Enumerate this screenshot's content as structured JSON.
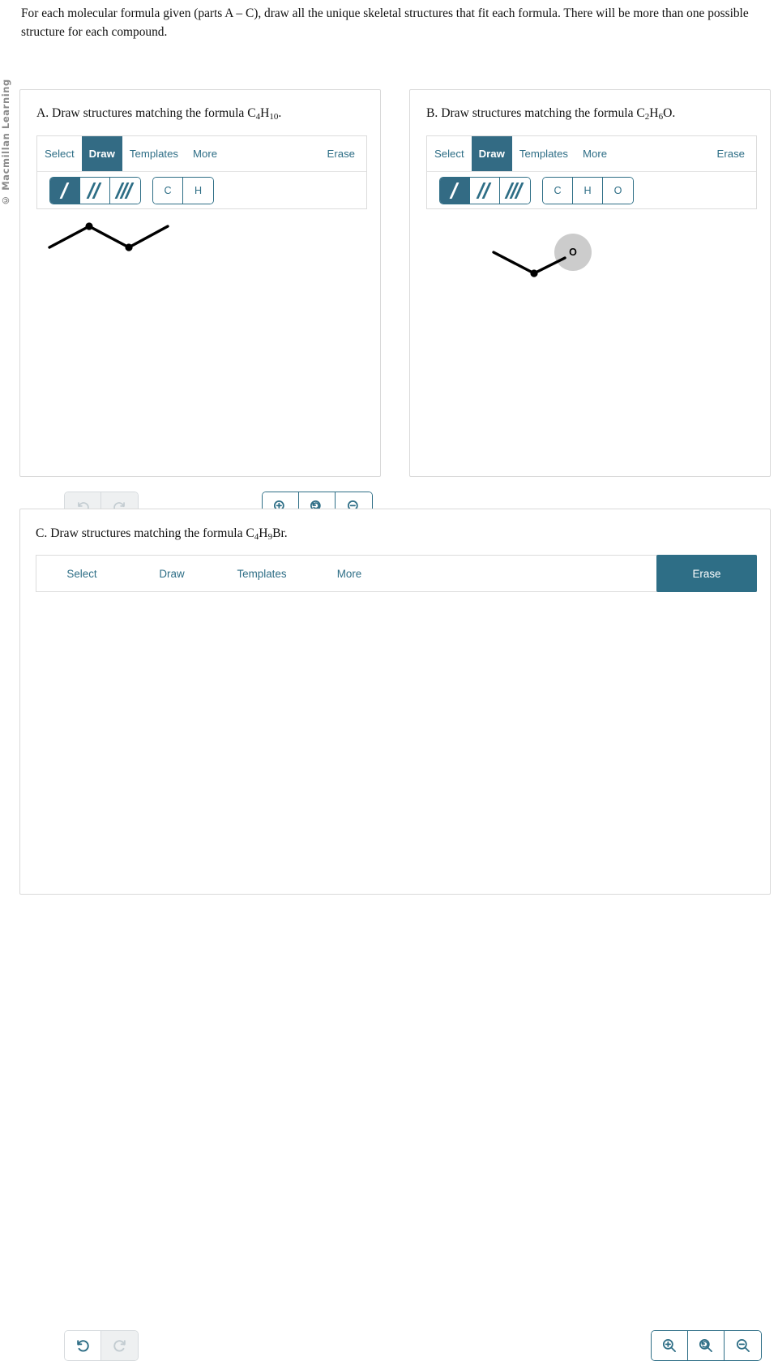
{
  "copyright": "© Macmillan Learning",
  "prompt": "For each molecular formula given (parts A – C), draw all the unique skeletal structures that fit each formula. There will be more than one possible structure for each compound.",
  "colors": {
    "accent": "#2e6e86",
    "accent_fill": "#336b84",
    "panel_border": "#d9d9d9",
    "editor_border": "#dcdcdc",
    "disabled_bg": "#eef0f1",
    "disabled_fg": "#c3ccd1",
    "atom_highlight": "#cccccc",
    "bond_stroke": "#000000"
  },
  "panels": [
    {
      "id": "a",
      "title_prefix": "A. Draw structures matching the formula C",
      "title_sub1": "4",
      "title_mid": "H",
      "title_sub2": "10",
      "title_suffix": ".",
      "formula": "C4H10",
      "tabs": [
        {
          "label": "Select",
          "active": false
        },
        {
          "label": "Draw",
          "active": true
        },
        {
          "label": "Templates",
          "active": false
        },
        {
          "label": "More",
          "active": false
        }
      ],
      "erase_label": "Erase",
      "bond_buttons": [
        {
          "name": "single-bond",
          "order": 1,
          "selected": true
        },
        {
          "name": "double-bond",
          "order": 2,
          "selected": false
        },
        {
          "name": "triple-bond",
          "order": 3,
          "selected": false
        }
      ],
      "atom_buttons": [
        {
          "label": "C",
          "selected": false
        },
        {
          "label": "H",
          "selected": false
        }
      ],
      "undo_enabled": false,
      "redo_enabled": false,
      "zoom_buttons": [
        "zoom-in",
        "zoom-reset",
        "zoom-out"
      ],
      "structure": {
        "type": "skeletal-chain",
        "points": [
          [
            15,
            46
          ],
          [
            64,
            20
          ],
          [
            113,
            46
          ],
          [
            161,
            20
          ]
        ],
        "vertex_dots": [
          [
            64,
            20
          ],
          [
            113,
            46
          ]
        ]
      }
    },
    {
      "id": "b",
      "title_prefix": "B. Draw structures matching the formula C",
      "title_sub1": "2",
      "title_mid": "H",
      "title_sub2": "6",
      "title_suffix": "O.",
      "formula": "C2H6O",
      "tabs": [
        {
          "label": "Select",
          "active": false
        },
        {
          "label": "Draw",
          "active": true
        },
        {
          "label": "Templates",
          "active": false
        },
        {
          "label": "More",
          "active": false
        }
      ],
      "erase_label": "Erase",
      "bond_buttons": [
        {
          "name": "single-bond",
          "order": 1,
          "selected": true
        },
        {
          "name": "double-bond",
          "order": 2,
          "selected": false
        },
        {
          "name": "triple-bond",
          "order": 3,
          "selected": false
        }
      ],
      "atom_buttons": [
        {
          "label": "C",
          "selected": false
        },
        {
          "label": "H",
          "selected": false
        },
        {
          "label": "O",
          "selected": false
        }
      ],
      "undo_enabled": false,
      "redo_enabled": false,
      "zoom_buttons": [
        "zoom-in",
        "zoom-reset",
        "zoom-out"
      ],
      "structure": {
        "type": "skeletal-chain-with-heteroatom",
        "points": [
          [
            82,
            52
          ],
          [
            132,
            78
          ],
          [
            170,
            59
          ]
        ],
        "vertex_dots": [
          [
            132,
            78
          ]
        ],
        "heteroatom_label": "O",
        "heteroatom_center": [
          180,
          52
        ],
        "heteroatom_radius": 23
      }
    },
    {
      "id": "c",
      "title_prefix": "C. Draw structures matching the formula C",
      "title_sub1": "4",
      "title_mid": "H",
      "title_sub2": "9",
      "title_suffix": "Br.",
      "formula": "C4H9Br",
      "tabs": [
        {
          "label": "Select",
          "active": false
        },
        {
          "label": "Draw",
          "active": false
        },
        {
          "label": "Templates",
          "active": false
        },
        {
          "label": "More",
          "active": false
        }
      ],
      "erase_label": "Erase",
      "erase_active": true,
      "bond_buttons": [],
      "atom_buttons": [],
      "undo_enabled": true,
      "redo_enabled": false,
      "zoom_buttons": [
        "zoom-in",
        "zoom-reset",
        "zoom-out"
      ],
      "structure": {
        "type": "empty",
        "points": [],
        "vertex_dots": []
      }
    }
  ]
}
